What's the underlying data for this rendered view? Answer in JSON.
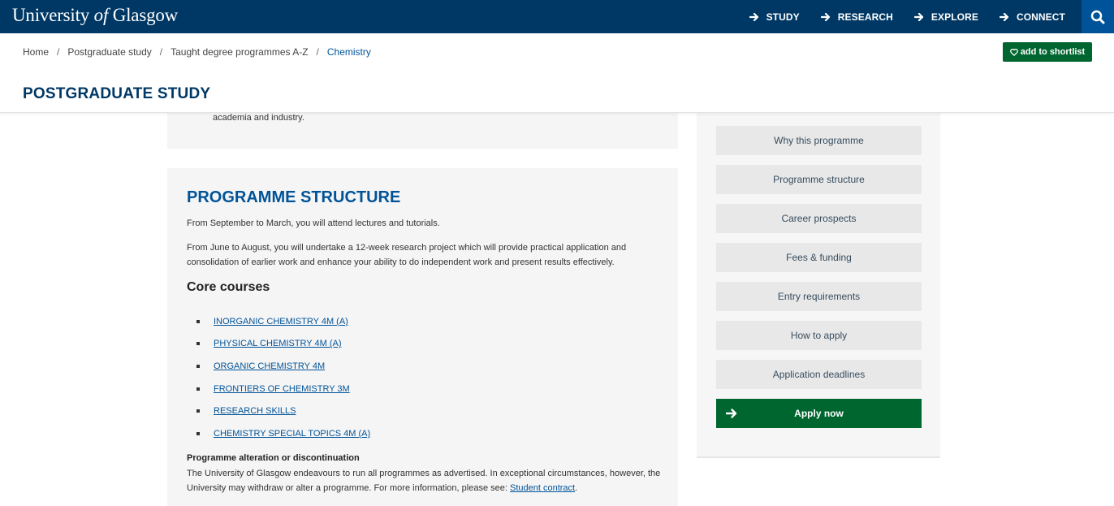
{
  "header": {
    "logo_pre": "University ",
    "logo_of": "of",
    "logo_post": " Glasgow",
    "nav": [
      {
        "label": "STUDY"
      },
      {
        "label": "RESEARCH"
      },
      {
        "label": "EXPLORE"
      },
      {
        "label": "CONNECT"
      }
    ],
    "search_icon": "search-icon"
  },
  "breadcrumb": [
    "Home",
    "Postgraduate study",
    "Taught degree programmes A-Z",
    "Chemistry"
  ],
  "shortlist_label": "add to shortlist",
  "section_title": "POSTGRADUATE STUDY",
  "prev_text": "academia and industry.",
  "programme_structure": {
    "heading": "PROGRAMME STRUCTURE",
    "para1": "From September to March, you will attend lectures and tutorials.",
    "para2": "From June to August, you will undertake a 12-week research project which will provide practical application and consolidation of earlier work and enhance your ability to do independent work and present results effectively.",
    "core_heading": "Core courses",
    "courses": [
      "INORGANIC CHEMISTRY 4M (A)",
      "PHYSICAL CHEMISTRY 4M (A)",
      "ORGANIC CHEMISTRY 4M",
      "FRONTIERS OF CHEMISTRY 3M",
      "RESEARCH SKILLS",
      "CHEMISTRY SPECIAL TOPICS 4M (A)"
    ],
    "alteration_title": "Programme alteration or discontinuation",
    "alteration_text": "The University of Glasgow endeavours to run all programmes as advertised. In exceptional circumstances, however, the University may withdraw or alter a programme. For more information, please see: ",
    "student_contract": "Student contract",
    "period": "."
  },
  "sidebar": {
    "links": [
      "Why this programme",
      "Programme structure",
      "Career prospects",
      "Fees & funding",
      "Entry requirements",
      "How to apply",
      "Application deadlines"
    ],
    "apply_label": "Apply now"
  },
  "colors": {
    "header_bg": "#003865",
    "search_bg": "#005398",
    "link_blue": "#005398",
    "green": "#006630"
  }
}
